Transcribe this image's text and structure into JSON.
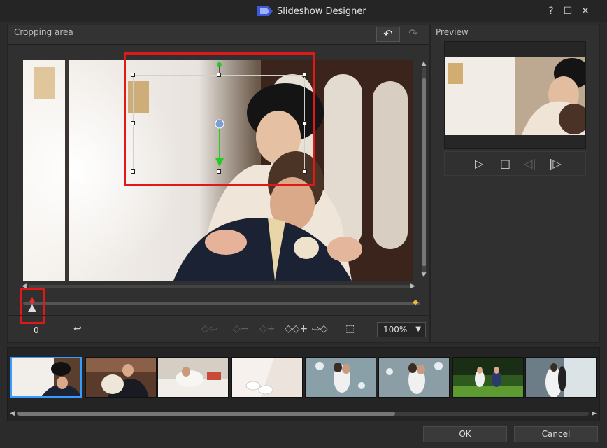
{
  "window": {
    "title": "Slideshow Designer",
    "help_glyph": "?",
    "maximize_glyph": "☐",
    "close_glyph": "✕"
  },
  "cropping": {
    "title": "Cropping area",
    "undo_glyph": "↶",
    "redo_glyph": "↷"
  },
  "timeline": {
    "time": "0",
    "progress": 0.0
  },
  "toolbar": {
    "return_glyph": "↩",
    "prev_kf_glyph": "◇⇦",
    "remove_kf_glyph": "◇−",
    "add_kf_glyph": "◇+",
    "dup_kf_glyph": "◇◇+",
    "next_kf_glyph": "⇨◇",
    "fit_glyph": "⬚",
    "zoom": "100%",
    "zoom_caret": "▼"
  },
  "preview": {
    "title": "Preview",
    "play_glyph": "▷",
    "stop_glyph": "□",
    "prev_frame_glyph": "◁|",
    "next_frame_glyph": "|▷"
  },
  "filmstrip": {
    "count": 8,
    "selected_index": 0
  },
  "buttons": {
    "ok": "OK",
    "cancel": "Cancel"
  },
  "colors": {
    "highlight_red": "#e01818",
    "selection_blue": "#3a9bff",
    "keyframe_gold": "#f0b43c",
    "motion_green": "#22cc22"
  }
}
